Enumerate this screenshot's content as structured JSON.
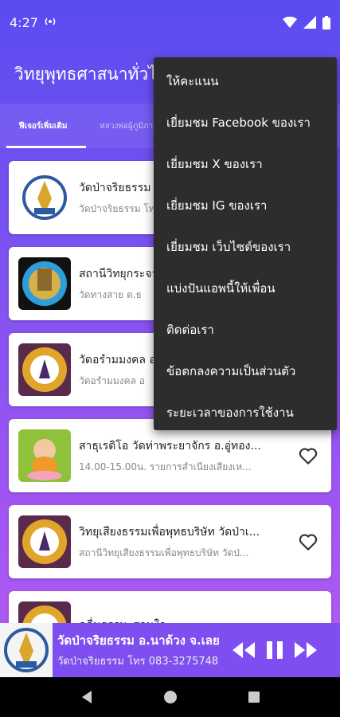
{
  "status": {
    "time": "4:27"
  },
  "appbar": {
    "title": "วิทยุพุทธศาสนาทั่วไทย"
  },
  "tabs": [
    {
      "label": "ฟีเจอร์เพิ่มเติม"
    },
    {
      "label": "หลวงพ่อผู้ภูมิภาค"
    }
  ],
  "list": [
    {
      "title": "วัดป่าจริยธรรม อ.นาด้วง จ.เลย",
      "subtitle": "วัดป่าจริยธรรม โทร 083-3275748"
    },
    {
      "title": "สถานีวิทยุกระจายเสียง",
      "subtitle": "วัดทางสาย ต.ธ"
    },
    {
      "title": "วัดอรำมมงคล อ",
      "subtitle": "วัดอรำมมงคล อ"
    },
    {
      "title": "สาธุเรดิโอ วัดท่าพระยาจักร อ.อู่ทอง...",
      "subtitle": "14.00-15.00น. รายการสำเนียงเสียงเห..."
    },
    {
      "title": "วิทยุเสียงธรรมเพื่อพุทธบริษัท วัดป่าเ...",
      "subtitle": "สถานีวิทยุเสียงธรรมเพื่อพุทธบริษัท วัดป่..."
    },
    {
      "title": "คลื่นธรรมะสอนใจ",
      "subtitle": ""
    }
  ],
  "menu": [
    "ให้คะแนน",
    "เยี่ยมชม Facebook ของเรา",
    "เยี่ยมชม X ของเรา",
    "เยี่ยมชม IG ของเรา",
    "เยี่ยมชม เว็บไซต์ของเรา",
    "แบ่งปันแอพนี้ให้เพื่อน",
    "ติดต่อเรา",
    "ข้อตกลงความเป็นส่วนตัว",
    "ระยะเวลาของการใช้งาน"
  ],
  "player": {
    "title": "วัดป่าจริยธรรม อ.นาด้วง จ.เลย",
    "subtitle": "วัดป่าจริยธรรม โทร 083-3275748"
  },
  "colors": {
    "accent": "#7e4ef0",
    "menu_bg": "#2d2d2d"
  }
}
